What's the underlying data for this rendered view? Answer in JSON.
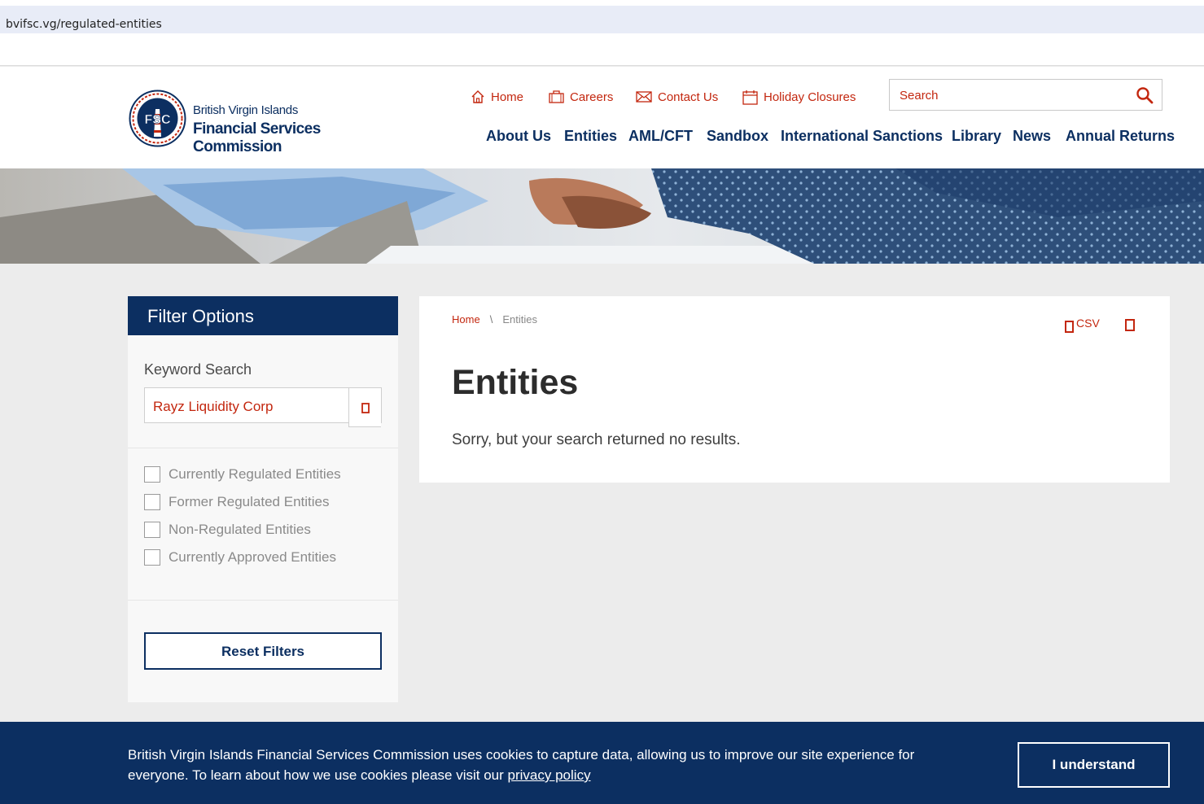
{
  "browser": {
    "url": "bvifsc.vg/regulated-entities"
  },
  "logo": {
    "line1": "British Virgin Islands",
    "line2": "Financial Services Commission",
    "seal_text": "FSC"
  },
  "top_nav": [
    {
      "label": "Home",
      "icon": "home-icon"
    },
    {
      "label": "Careers",
      "icon": "briefcase-icon"
    },
    {
      "label": "Contact Us",
      "icon": "envelope-icon"
    },
    {
      "label": "Holiday Closures",
      "icon": "calendar-icon"
    }
  ],
  "search": {
    "placeholder": "Search"
  },
  "main_nav": [
    "About Us",
    "Entities",
    "AML/CFT",
    "Sandbox",
    "International Sanctions",
    "Library",
    "News",
    "Annual Returns"
  ],
  "filter": {
    "title": "Filter Options",
    "keyword_label": "Keyword Search",
    "keyword_value": "Rayz Liquidity Corp",
    "checkboxes": [
      "Currently Regulated Entities",
      "Former Regulated Entities",
      "Non-Regulated Entities",
      "Currently Approved Entities"
    ],
    "reset_label": "Reset Filters"
  },
  "content": {
    "breadcrumb": {
      "home": "Home",
      "separator": "\\",
      "current": "Entities"
    },
    "csv_label": "CSV",
    "title": "Entities",
    "message": "Sorry, but your search returned no results."
  },
  "cookie": {
    "text": "British Virgin Islands Financial Services Commission uses cookies to capture data, allowing us to improve our site experience for everyone. To learn about how we use cookies please visit our",
    "link": "privacy policy",
    "button": "I understand"
  },
  "colors": {
    "navy": "#0c2f61",
    "accent_red": "#c3270f",
    "page_bg": "#ececec"
  }
}
